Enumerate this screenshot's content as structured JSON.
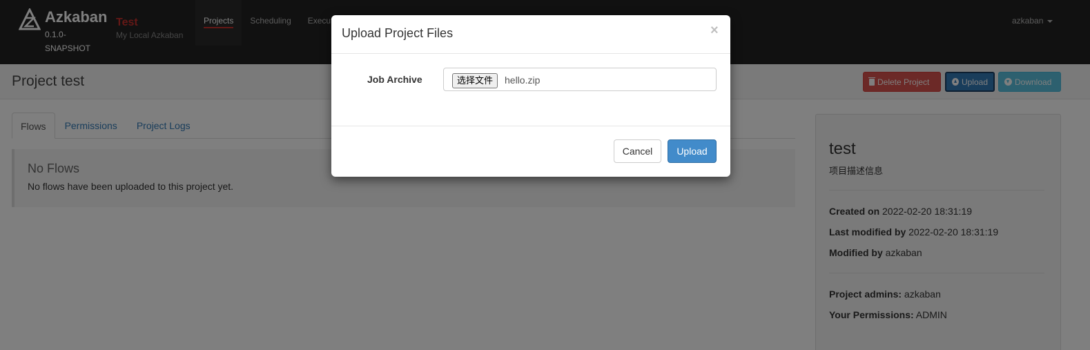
{
  "navbar": {
    "brand_name": "Azkaban",
    "brand_version": "0.1.0-SNAPSHOT",
    "env_name": "Test",
    "env_desc": "My Local Azkaban",
    "links": [
      "Projects",
      "Scheduling",
      "Executing"
    ],
    "user": "azkaban"
  },
  "header": {
    "title": "Project test",
    "delete_label": "Delete Project",
    "upload_label": "Upload",
    "download_label": "Download"
  },
  "tabs": [
    "Flows",
    "Permissions",
    "Project Logs"
  ],
  "flows": {
    "title": "No Flows",
    "text": "No flows have been uploaded to this project yet."
  },
  "side": {
    "name": "test",
    "desc": "项目描述信息",
    "created_label": "Created on",
    "created_value": "2022-02-20 18:31:19",
    "modified_label": "Last modified by",
    "modified_value": "2022-02-20 18:31:19",
    "modified_by_label": "Modified by",
    "modified_by_value": "azkaban",
    "admins_label": "Project admins:",
    "admins_value": "azkaban",
    "perms_label": "Your Permissions:",
    "perms_value": "ADMIN"
  },
  "modal": {
    "title": "Upload Project Files",
    "close": "×",
    "field_label": "Job Archive",
    "file_button": "选择文件",
    "file_name": "hello.zip",
    "cancel_label": "Cancel",
    "upload_label": "Upload"
  }
}
